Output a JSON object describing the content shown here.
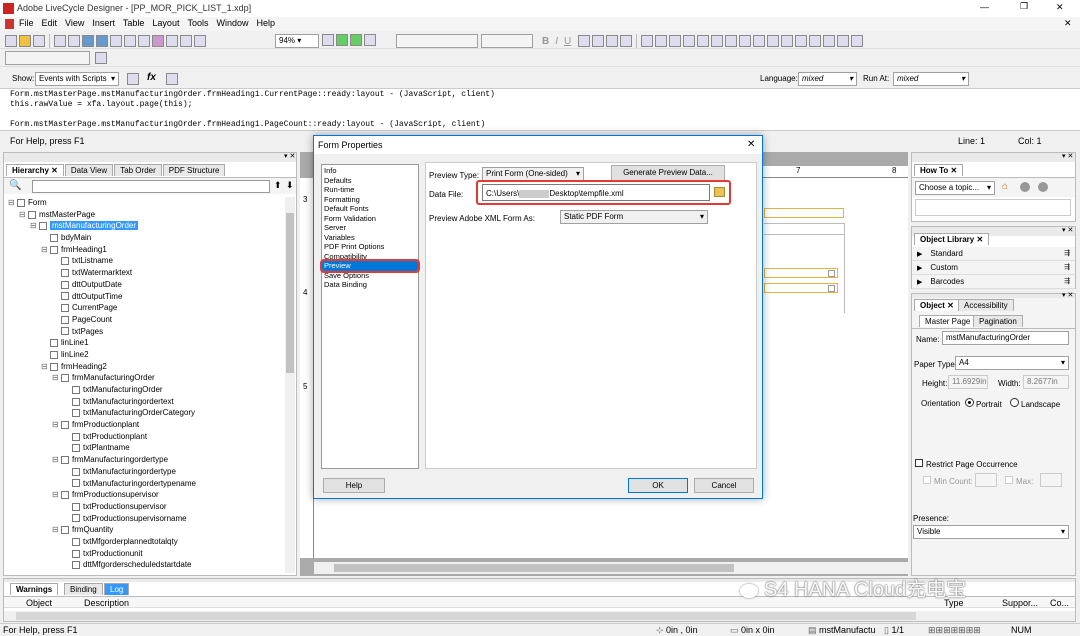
{
  "window": {
    "title": "Adobe LiveCycle Designer - [PP_MOR_PICK_LIST_1.xdp]",
    "min": "—",
    "restore": "❐",
    "close": "✕"
  },
  "menu": [
    "File",
    "Edit",
    "View",
    "Insert",
    "Table",
    "Layout",
    "Tools",
    "Window",
    "Help"
  ],
  "toolbar": {
    "zoom": "94%"
  },
  "script_bar": {
    "show_label": "Show:",
    "show_value": "Events with Scripts",
    "language_label": "Language:",
    "language_value": "mixed",
    "run_at_label": "Run At:",
    "run_at_value": "mixed"
  },
  "script_lines": [
    "Form.mstMasterPage.mstManufacturingOrder.frmHeading1.CurrentPage::ready:layout - (JavaScript, client)",
    "this.rawValue = xfa.layout.page(this);",
    "",
    "Form.mstMasterPage.mstManufacturingOrder.frmHeading1.PageCount::ready:layout - (JavaScript, client)"
  ],
  "help_bar": {
    "text": "For Help, press F1",
    "line": "Line: 1",
    "col": "Col: 1"
  },
  "hierarchy": {
    "tabs": [
      "Hierarchy",
      "Data View",
      "Tab Order",
      "PDF Structure"
    ],
    "items": [
      {
        "label": "Form",
        "depth": 0
      },
      {
        "label": "mstMasterPage",
        "depth": 1
      },
      {
        "label": "mstManufacturingOrder",
        "depth": 2,
        "selected": true
      },
      {
        "label": "bdyMain",
        "depth": 3
      },
      {
        "label": "frmHeading1",
        "depth": 3
      },
      {
        "label": "txtListname",
        "depth": 4
      },
      {
        "label": "txtWatermarktext",
        "depth": 4
      },
      {
        "label": "dttOutputDate",
        "depth": 4
      },
      {
        "label": "dttOutputTime",
        "depth": 4
      },
      {
        "label": "CurrentPage",
        "depth": 4
      },
      {
        "label": "PageCount",
        "depth": 4
      },
      {
        "label": "txtPages",
        "depth": 4
      },
      {
        "label": "linLine1",
        "depth": 3
      },
      {
        "label": "linLine2",
        "depth": 3
      },
      {
        "label": "frmHeading2",
        "depth": 3
      },
      {
        "label": "frmManufacturingOrder",
        "depth": 4
      },
      {
        "label": "txtManufacturingOrder",
        "depth": 5
      },
      {
        "label": "txtManufacturingordertext",
        "depth": 5
      },
      {
        "label": "txtManufacturingOrderCategory",
        "depth": 5
      },
      {
        "label": "frmProductionplant",
        "depth": 4
      },
      {
        "label": "txtProductionplant",
        "depth": 5
      },
      {
        "label": "txtPlantname",
        "depth": 5
      },
      {
        "label": "frmManufacturingordertype",
        "depth": 4
      },
      {
        "label": "txtManufacturingordertype",
        "depth": 5
      },
      {
        "label": "txtManufacturingordertypename",
        "depth": 5
      },
      {
        "label": "frmProductionsupervisor",
        "depth": 4
      },
      {
        "label": "txtProductionsupervisor",
        "depth": 5
      },
      {
        "label": "txtProductionsupervisorname",
        "depth": 5
      },
      {
        "label": "frmQuantity",
        "depth": 4
      },
      {
        "label": "txtMfgorderplannedtotalqty",
        "depth": 5
      },
      {
        "label": "txtProductionunit",
        "depth": 5
      },
      {
        "label": "dttMfgorderscheduledstartdate",
        "depth": 5
      }
    ]
  },
  "ruler": {
    "top": [
      "7",
      "8"
    ],
    "left": [
      "3",
      "4",
      "5"
    ]
  },
  "dialog": {
    "title": "Form Properties",
    "close": "✕",
    "categories": [
      "Info",
      "Defaults",
      "Run-time",
      "Formatting",
      "Default Fonts",
      "Form Validation",
      "Server",
      "Variables",
      "PDF Print Options",
      "Compatibility",
      "Preview",
      "Save Options",
      "Data Binding"
    ],
    "selected": "Preview",
    "preview_type_label": "Preview Type:",
    "preview_type_value": "Print Form (One-sided)",
    "generate_button": "Generate Preview Data...",
    "data_file_label": "Data File:",
    "data_file_prefix": "C:\\Users\\",
    "data_file_suffix": "Desktop\\tempfile.xml",
    "preview_as_label": "Preview Adobe XML Form As:",
    "preview_as_value": "Static PDF Form",
    "help_button": "Help",
    "ok_button": "OK",
    "cancel_button": "Cancel"
  },
  "howto": {
    "title": "How To",
    "dropdown": "Choose a topic..."
  },
  "object_library": {
    "title": "Object Library",
    "items": [
      "Standard",
      "Custom",
      "Barcodes"
    ]
  },
  "object_panel": {
    "tabs": [
      "Object",
      "Accessibility"
    ],
    "subtabs": [
      "Master Page",
      "Pagination"
    ],
    "name_label": "Name:",
    "name_value": "mstManufacturingOrder",
    "paper_label": "Paper Type:",
    "paper_value": "A4",
    "height_label": "Height:",
    "height_value": "11.6929in",
    "width_label": "Width:",
    "width_value": "8.2677in",
    "orientation_label": "Orientation",
    "portrait": "Portrait",
    "landscape": "Landscape",
    "restrict_label": "Restrict Page Occurrence",
    "min_label": "Min Count:",
    "max_label": "Max:",
    "presence_label": "Presence:",
    "presence_value": "Visible"
  },
  "bottom_panel": {
    "tabs": [
      "Warnings",
      "Binding",
      "Log"
    ],
    "headers": [
      "Object",
      "Description"
    ],
    "right_headers": [
      "Type",
      "Suppor...",
      "Co..."
    ]
  },
  "watermark": "S4 HANA Cloud充电宝",
  "status": {
    "help": "For Help, press F1",
    "pos": "0in , 0in",
    "size": "0in x 0in",
    "object": "mstManufactu",
    "page": "1/1",
    "num": "NUM"
  },
  "colors": {
    "selection": "#3399ff",
    "dialog_accent": "#0078d7",
    "highlight": "#e53935"
  }
}
